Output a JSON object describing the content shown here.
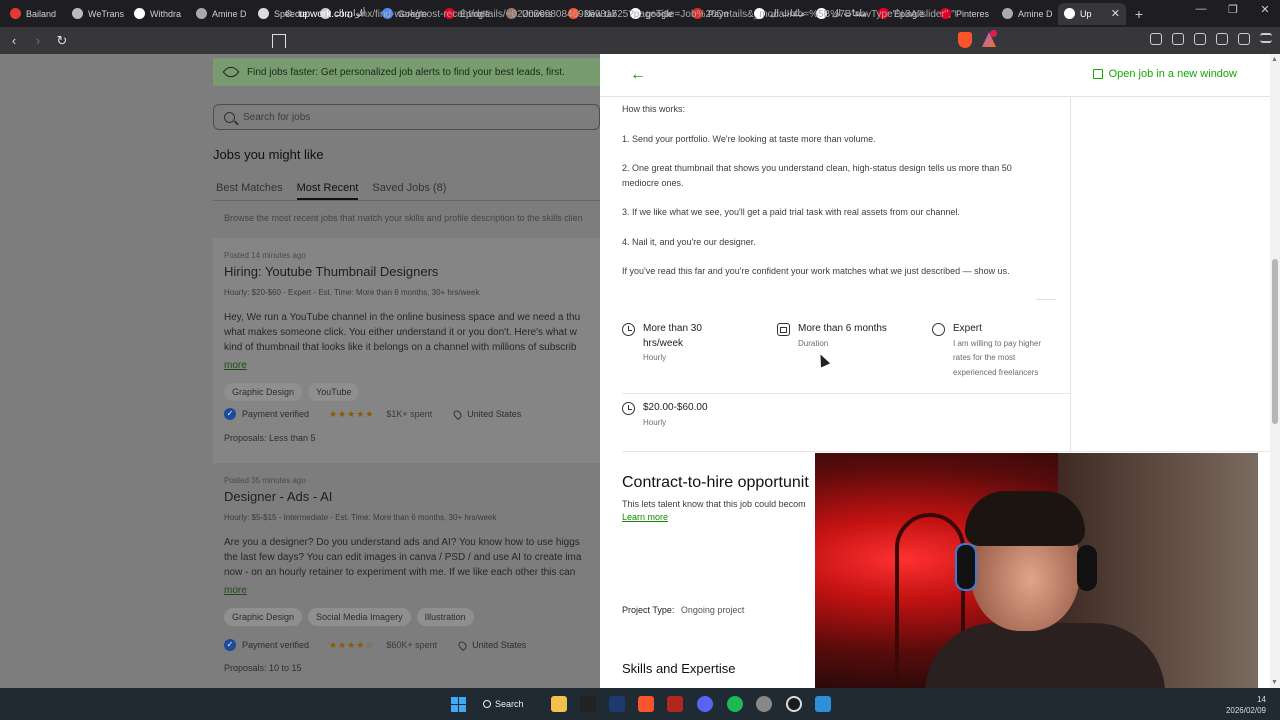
{
  "browser": {
    "tabs": [
      {
        "label": "Bailand",
        "color": "#e53935"
      },
      {
        "label": "WeTrans",
        "color": "#bbbbbb"
      },
      {
        "label": "Withdra",
        "color": "#ffffff"
      },
      {
        "label": "Amine D",
        "color": "#aaaaaa"
      },
      {
        "label": "Speedte",
        "color": "#dddddd"
      },
      {
        "label": "ألوان الـ",
        "color": "#cccccc"
      },
      {
        "label": "Google",
        "color": "#4c8bf5"
      },
      {
        "label": "Épinglé",
        "color": "#e60023"
      },
      {
        "label": "Univers",
        "color": "#9c7b6b"
      },
      {
        "label": "New tab",
        "color": "#fb542b"
      },
      {
        "label": "google",
        "color": "#ffffff"
      },
      {
        "label": "Payn",
        "color": "#d93025"
      },
      {
        "label": "ملفات ال",
        "color": "#ffffff"
      },
      {
        "label": "ملفات ال",
        "color": "#ffffff"
      },
      {
        "label": "Épinglé",
        "color": "#e60023"
      },
      {
        "label": "Pinteres",
        "color": "#e60023"
      },
      {
        "label": "Amine D",
        "color": "#aaaaaa"
      },
      {
        "label": "Up",
        "color": "#ffffff"
      }
    ],
    "new_tab": "+",
    "url_host": "upwork.com",
    "url_rest": "/nx/find-work/most-recent/details/~022020980846926931725?pageTitle=Job%20Details&_modalInfo=%5B%7B\"navType\"%3A\"slider\",\"ti..."
  },
  "left": {
    "alert_text": "Find jobs faster: Get personalized job alerts to find your best leads, first.",
    "search_placeholder": "Search for jobs",
    "jobs_title": "Jobs you might like",
    "tabs": [
      "Best Matches",
      "Most Recent",
      "Saved Jobs (8)"
    ],
    "active_tab": "Most Recent",
    "browse_text": "Browse the most recent jobs that match your skills and profile description to the skills clien",
    "jobs": [
      {
        "posted": "Posted 14 minutes ago",
        "title": "Hiring: Youtube Thumbnail Designers",
        "meta": "Hourly: $20-$60 - Expert - Est. Time: More than 6 months, 30+ hrs/week",
        "desc": [
          "Hey, We run a YouTube channel in the online business space and we need a thu",
          "what makes someone click. You either understand it or you don't. Here's what w",
          "kind of thumbnail that looks like it belongs on a channel with millions of subscrib"
        ],
        "more": "more",
        "skills": [
          "Graphic Design",
          "YouTube"
        ],
        "payment": "Payment verified",
        "rating": 5,
        "spent": "$1K+ spent",
        "location": "United States",
        "proposals": "Proposals: Less than 5"
      },
      {
        "posted": "Posted 35 minutes ago",
        "title": "Designer - Ads - AI",
        "meta": "Hourly: $5-$15 - Intermediate - Est. Time: More than 6 months, 30+ hrs/week",
        "desc": [
          "Are you a designer? Do you understand ads and AI? You know how to use higgs",
          "the last few days? You can edit images in canva / PSD / and use AI to create ima",
          "now - on an hourly retainer to experiment with me. If we like each other this can"
        ],
        "more": "more",
        "skills": [
          "Graphic Design",
          "Social Media Imagery",
          "Illustration"
        ],
        "payment": "Payment verified",
        "rating": 4.5,
        "spent": "$60K+ spent",
        "location": "United States",
        "proposals": "Proposals: 10 to 15"
      }
    ]
  },
  "panel": {
    "open_job": "Open job in a new window",
    "how_title": "How this works:",
    "steps": [
      "1. Send your portfolio. We're looking at taste more than volume.",
      "2. One great thumbnail that shows you understand clean, high-status design tells us more than 50",
      "mediocre ones.",
      "3. If we like what we see, you'll get a paid trial task with real assets from our channel.",
      "4. Nail it, and you're our designer."
    ],
    "closing": "If you've read this far and you're confident your work matches what we just described — show us.",
    "features": {
      "hours_title_1": "More than 30",
      "hours_title_2": "hrs/week",
      "hours_sub": "Hourly",
      "duration_title": "More than 6 months",
      "duration_sub": "Duration",
      "level_title": "Expert",
      "level_sub_1": "I am willing to pay higher",
      "level_sub_2": "rates for the most",
      "level_sub_3": "experienced freelancers",
      "rate_title": "$20.00-$60.00",
      "rate_sub": "Hourly"
    },
    "contract_title": "Contract-to-hire opportunit",
    "contract_desc": "This lets talent know that this job could becom",
    "learn_more": "Learn more",
    "project_type_label": "Project Type:",
    "project_type_value": "Ongoing project",
    "skills_title": "Skills and Expertise"
  },
  "taskbar": {
    "search": "Search",
    "temp": "14",
    "date": "2026/02/09"
  }
}
